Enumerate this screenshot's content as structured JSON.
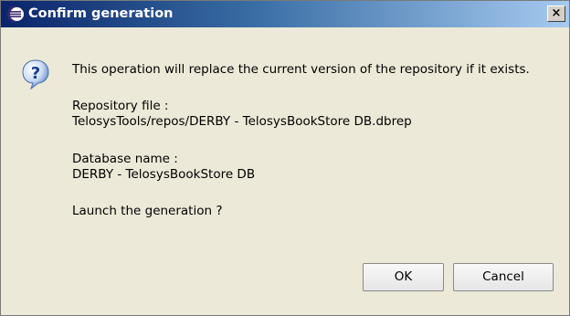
{
  "window": {
    "title": "Confirm generation",
    "close_glyph": "×"
  },
  "icons": {
    "app": "eclipse-icon",
    "message": "question-icon"
  },
  "message": {
    "line1": "This operation will replace the current version of the repository if it exists.",
    "repo_label": "Repository file :",
    "repo_value": "TelosysTools/repos/DERBY - TelosysBookStore DB.dbrep",
    "db_label": "Database name :",
    "db_value": "DERBY - TelosysBookStore DB",
    "prompt": "Launch the generation ?"
  },
  "buttons": {
    "ok": "OK",
    "cancel": "Cancel"
  },
  "colors": {
    "titlebar_start": "#0a246a",
    "titlebar_end": "#a6caf0",
    "dialog_bg": "#ece9d8"
  }
}
